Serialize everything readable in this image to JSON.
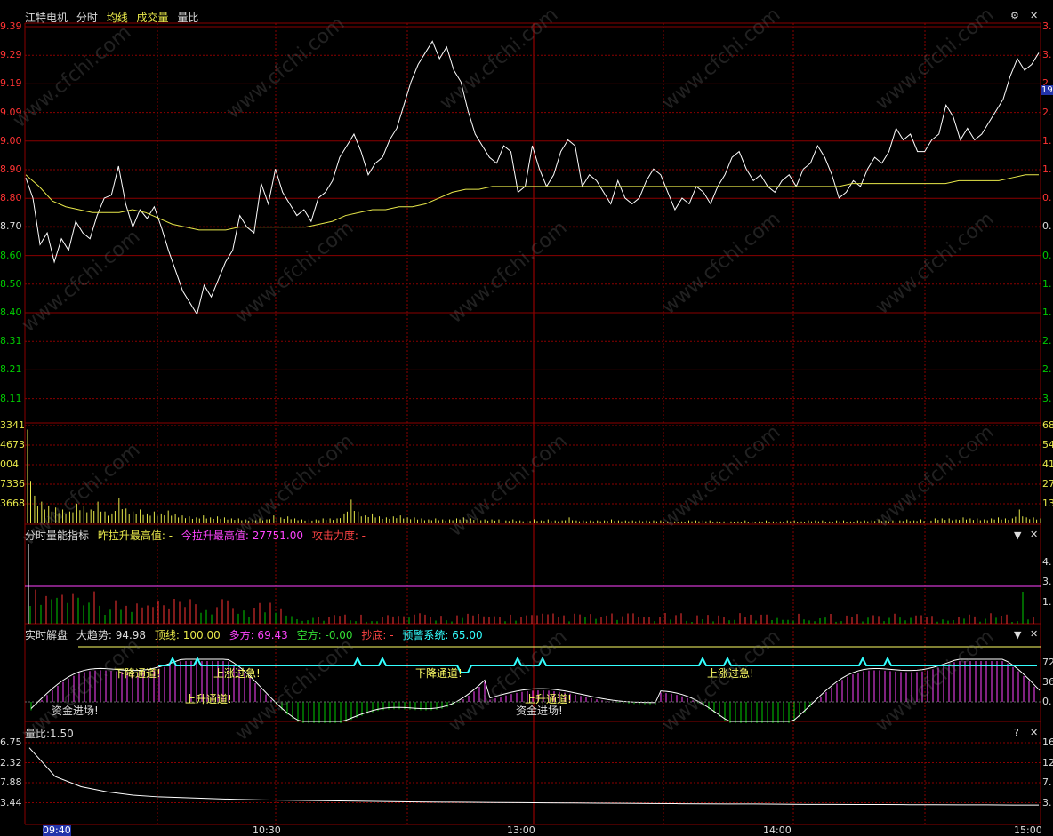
{
  "stock_name": "江特电机",
  "price_header": {
    "tab1": "分时",
    "tab2": "均线",
    "tab3": "成交量",
    "tab4": "量比"
  },
  "colors": {
    "up": "#ff3333",
    "down": "#00cc00",
    "price": "#ffffff",
    "avg": "#e8e84a",
    "grid": "#8a0000",
    "magenta": "#ff44ff",
    "cyan": "#33ffff",
    "yellow": "#ffff66"
  },
  "price_axis": {
    "left_ticks": [
      "9.39",
      "9.29",
      "9.19",
      "9.09",
      "9.00",
      "8.90",
      "8.80",
      "8.70",
      "8.60",
      "8.50",
      "8.40",
      "8.31",
      "8.21",
      "8.11"
    ],
    "right_ticks": [
      "3.",
      "3.",
      "2",
      "2.",
      "1.",
      "1.",
      "0.",
      "0.",
      "0.",
      "1.",
      "1.",
      "2.",
      "2.",
      "3."
    ],
    "current_tag": "19"
  },
  "volume_axis": {
    "left_ticks": [
      "3341",
      "4673",
      "004",
      "7336",
      "3668"
    ],
    "right_ticks": [
      "68",
      "54",
      "41",
      "27",
      "13"
    ]
  },
  "indicator1": {
    "title": "分时量能指标",
    "f1": "昨拉升最高值: -",
    "f2": "今拉升最高值: 27751.00",
    "f3": "攻击力度: -",
    "right_ticks": [
      "4.",
      "3.",
      "1."
    ]
  },
  "indicator2": {
    "title": "实时解盘",
    "f1": "大趋势: 94.98",
    "f2": "顶线: 100.00",
    "f3": "多方: 69.43",
    "f4": "空方: -0.00",
    "f5": "抄底: -",
    "f6": "预警系统: 65.00",
    "right_ticks": [
      "72",
      "36",
      "0."
    ],
    "annotations": [
      "下降通道!",
      "上涨过急!",
      "下降通道!",
      "上涨过急!",
      "上升通道!",
      "上升通道!",
      "资金进场!",
      "资金进场!"
    ]
  },
  "indicator3": {
    "title": "量比:1.50",
    "left_ticks": [
      "6.75",
      "2.32",
      "7.88",
      "3.44"
    ],
    "right_ticks": [
      "16",
      "12",
      "7.",
      "3."
    ]
  },
  "time_axis": [
    "09:40",
    "10:30",
    "13:00",
    "14:00",
    "15:00"
  ],
  "watermark": "www.cfchi.com",
  "chart_data": {
    "type": "line",
    "title": "江特电机 分时",
    "x_range": [
      "09:30",
      "15:00"
    ],
    "ylim": [
      8.11,
      9.39
    ],
    "reference_price": 8.7,
    "series": [
      {
        "name": "分时",
        "values": [
          8.87,
          8.8,
          8.64,
          8.68,
          8.58,
          8.66,
          8.62,
          8.72,
          8.68,
          8.66,
          8.74,
          8.8,
          8.81,
          8.91,
          8.78,
          8.7,
          8.76,
          8.73,
          8.77,
          8.7,
          8.62,
          8.55,
          8.48,
          8.44,
          8.4,
          8.5,
          8.46,
          8.52,
          8.58,
          8.62,
          8.74,
          8.7,
          8.68,
          8.85,
          8.78,
          8.9,
          8.82,
          8.78,
          8.74,
          8.76,
          8.72,
          8.8,
          8.82,
          8.86,
          8.94,
          8.98,
          9.02,
          8.96,
          8.88,
          8.92,
          8.94,
          9.0,
          9.04,
          9.12,
          9.2,
          9.26,
          9.3,
          9.34,
          9.28,
          9.32,
          9.24,
          9.2,
          9.1,
          9.02,
          8.98,
          8.94,
          8.92,
          8.98,
          8.96,
          8.82,
          8.84,
          8.98,
          8.9,
          8.84,
          8.88,
          8.96,
          9.0,
          8.98,
          8.84,
          8.88,
          8.86,
          8.82,
          8.78,
          8.86,
          8.8,
          8.78,
          8.8,
          8.86,
          8.9,
          8.88,
          8.82,
          8.76,
          8.8,
          8.78,
          8.84,
          8.82,
          8.78,
          8.84,
          8.88,
          8.94,
          8.96,
          8.9,
          8.86,
          8.88,
          8.84,
          8.82,
          8.86,
          8.88,
          8.84,
          8.9,
          8.92,
          8.98,
          8.94,
          8.88,
          8.8,
          8.82,
          8.86,
          8.84,
          8.9,
          8.94,
          8.92,
          8.96,
          9.04,
          9.0,
          9.02,
          8.96,
          8.96,
          9.0,
          9.02,
          9.12,
          9.08,
          9.0,
          9.04,
          9.0,
          9.02,
          9.06,
          9.1,
          9.14,
          9.22,
          9.28,
          9.24,
          9.26,
          9.3
        ]
      },
      {
        "name": "均线",
        "values": [
          8.88,
          8.84,
          8.79,
          8.77,
          8.76,
          8.75,
          8.75,
          8.75,
          8.76,
          8.75,
          8.73,
          8.71,
          8.7,
          8.69,
          8.69,
          8.69,
          8.7,
          8.7,
          8.7,
          8.7,
          8.7,
          8.7,
          8.71,
          8.72,
          8.74,
          8.75,
          8.76,
          8.76,
          8.77,
          8.77,
          8.78,
          8.8,
          8.82,
          8.83,
          8.83,
          8.84,
          8.84,
          8.84,
          8.84,
          8.84,
          8.84,
          8.84,
          8.84,
          8.84,
          8.84,
          8.84,
          8.84,
          8.84,
          8.84,
          8.84,
          8.84,
          8.84,
          8.84,
          8.84,
          8.84,
          8.84,
          8.84,
          8.84,
          8.84,
          8.84,
          8.84,
          8.84,
          8.85,
          8.85,
          8.85,
          8.85,
          8.85,
          8.85,
          8.85,
          8.85,
          8.86,
          8.86,
          8.86,
          8.86,
          8.87,
          8.88,
          8.88
        ]
      }
    ],
    "volume": [
      95,
      28,
      22,
      18,
      16,
      14,
      12,
      20,
      18,
      14,
      22,
      12,
      10,
      26,
      15,
      12,
      14,
      10,
      12,
      10,
      13,
      9,
      8,
      7,
      6,
      8,
      6,
      7,
      6,
      5,
      5,
      4,
      4,
      5,
      4,
      8,
      6,
      7,
      5,
      4,
      4,
      4,
      5,
      5,
      5,
      10,
      24,
      12,
      8,
      10,
      7,
      6,
      7,
      8,
      6,
      6,
      5,
      4,
      5,
      4,
      4,
      5,
      6,
      5,
      5,
      4,
      4,
      4,
      3,
      4,
      3,
      3,
      4,
      3,
      4,
      3,
      3,
      6,
      3,
      3,
      3,
      3,
      3,
      4,
      3,
      3,
      3,
      3,
      3,
      3,
      3,
      2,
      2,
      2,
      3,
      3,
      3,
      3,
      2,
      2,
      2,
      2,
      3,
      2,
      2,
      3,
      2,
      2,
      3,
      3,
      2,
      3,
      3,
      3,
      2,
      3,
      3,
      2,
      3,
      3,
      3,
      4,
      3,
      3,
      3,
      4,
      3,
      4,
      3,
      5,
      5,
      5,
      4,
      6,
      5,
      5,
      4,
      5,
      6,
      5,
      5,
      14,
      6,
      6,
      5
    ],
    "volume_ticks": [
      "3341",
      "4673",
      "004",
      "7336",
      "3668"
    ],
    "liangbi": [
      6.9,
      5.2,
      4.6,
      4.3,
      4.1,
      4.0,
      3.95,
      3.9,
      3.85,
      3.82,
      3.8,
      3.78,
      3.76,
      3.74,
      3.72,
      3.7,
      3.69,
      3.68,
      3.67,
      3.66,
      3.65,
      3.64,
      3.63,
      3.62,
      3.61,
      3.6,
      3.59,
      3.58,
      3.58,
      3.57,
      3.56,
      3.56,
      3.55,
      3.55,
      3.54,
      3.54,
      3.53,
      3.53,
      3.52,
      3.52
    ],
    "liangbi_ylim": [
      3.0,
      7.2
    ]
  }
}
